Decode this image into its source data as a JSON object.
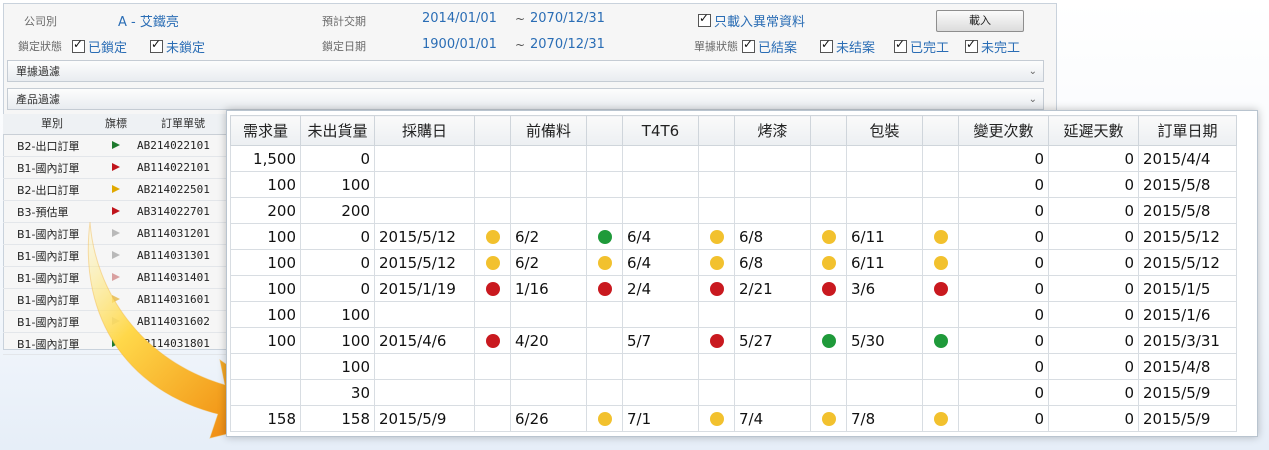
{
  "filters": {
    "company_label": "公司別",
    "company_value": "A - 艾鐵亮",
    "lock_status_label": "鎖定狀態",
    "lock_options": [
      "已鎖定",
      "未鎖定"
    ],
    "expected_label": "預計交期",
    "expected_from": "2014/01/01",
    "expected_to": "2070/12/31",
    "lock_date_label": "鎖定日期",
    "lock_from": "1900/01/01",
    "lock_to": "2070/12/31",
    "range_sep": "~",
    "abnormal_only": "只載入異常資料",
    "doc_status_label": "單據狀態",
    "doc_status_options": [
      "已結案",
      "未结案",
      "已完工",
      "未完工"
    ],
    "import_button": "載入"
  },
  "sections": {
    "doc_filter": "單據過濾",
    "product_filter": "產品過濾"
  },
  "left_table": {
    "headers": [
      "單別",
      "旗標",
      "訂單單號"
    ],
    "rows": [
      {
        "type": "B2-出口訂單",
        "flag_color": "#1e7a2e",
        "no": "AB214022101"
      },
      {
        "type": "B1-國內訂單",
        "flag_color": "#c0141b",
        "no": "AB114022101"
      },
      {
        "type": "B2-出口訂單",
        "flag_color": "#e0a800",
        "no": "AB214022501"
      },
      {
        "type": "B3-預估單",
        "flag_color": "#c0141b",
        "no": "AB314022701"
      },
      {
        "type": "B1-國內訂單",
        "flag_color": "#b9b9b9",
        "no": "AB114031201"
      },
      {
        "type": "B1-國內訂單",
        "flag_color": "#b9b9b9",
        "no": "AB114031301"
      },
      {
        "type": "B1-國內訂單",
        "flag_color": "#d9a0a0",
        "no": "AB114031401"
      },
      {
        "type": "B1-國內訂單",
        "flag_color": "#e8c46a",
        "no": "AB114031601"
      },
      {
        "type": "B1-國內訂單",
        "flag_color": "#b9b9b9",
        "no": "AB114031602"
      },
      {
        "type": "B1-國內訂單",
        "flag_color": "#1e7a2e",
        "no": "AB114031801"
      }
    ]
  },
  "grid": {
    "headers": [
      "需求量",
      "未出貨量",
      "採購日",
      "",
      "前備料",
      "",
      "T4T6",
      "",
      "烤漆",
      "",
      "包裝",
      "",
      "變更次數",
      "延遲天數",
      "訂單日期"
    ],
    "rows": [
      {
        "demand": "1,500",
        "unshipped": "0",
        "purchase": "",
        "purchase_dot": "",
        "prep": "",
        "prep_dot": "",
        "t4t6": "",
        "t4t6_dot": "",
        "paint": "",
        "paint_dot": "",
        "pack": "",
        "pack_dot": "",
        "changes": "0",
        "delay": "0",
        "order_date": "2015/4/4"
      },
      {
        "demand": "100",
        "unshipped": "100",
        "purchase": "",
        "purchase_dot": "",
        "prep": "",
        "prep_dot": "",
        "t4t6": "",
        "t4t6_dot": "",
        "paint": "",
        "paint_dot": "",
        "pack": "",
        "pack_dot": "",
        "changes": "0",
        "delay": "0",
        "order_date": "2015/5/8"
      },
      {
        "demand": "200",
        "unshipped": "200",
        "purchase": "",
        "purchase_dot": "",
        "prep": "",
        "prep_dot": "",
        "t4t6": "",
        "t4t6_dot": "",
        "paint": "",
        "paint_dot": "",
        "pack": "",
        "pack_dot": "",
        "changes": "0",
        "delay": "0",
        "order_date": "2015/5/8"
      },
      {
        "demand": "100",
        "unshipped": "0",
        "purchase": "2015/5/12",
        "purchase_dot": "yellow",
        "prep": "6/2",
        "prep_dot": "green",
        "t4t6": "6/4",
        "t4t6_dot": "yellow",
        "paint": "6/8",
        "paint_dot": "yellow",
        "pack": "6/11",
        "pack_dot": "yellow",
        "changes": "0",
        "delay": "0",
        "order_date": "2015/5/12"
      },
      {
        "demand": "100",
        "unshipped": "0",
        "purchase": "2015/5/12",
        "purchase_dot": "yellow",
        "prep": "6/2",
        "prep_dot": "yellow",
        "t4t6": "6/4",
        "t4t6_dot": "yellow",
        "paint": "6/8",
        "paint_dot": "yellow",
        "pack": "6/11",
        "pack_dot": "yellow",
        "changes": "0",
        "delay": "0",
        "order_date": "2015/5/12"
      },
      {
        "demand": "100",
        "unshipped": "0",
        "purchase": "2015/1/19",
        "purchase_dot": "red",
        "prep": "1/16",
        "prep_dot": "red",
        "t4t6": "2/4",
        "t4t6_dot": "red",
        "paint": "2/21",
        "paint_dot": "red",
        "pack": "3/6",
        "pack_dot": "red",
        "changes": "0",
        "delay": "0",
        "order_date": "2015/1/5"
      },
      {
        "demand": "100",
        "unshipped": "100",
        "purchase": "",
        "purchase_dot": "",
        "prep": "",
        "prep_dot": "",
        "t4t6": "",
        "t4t6_dot": "",
        "paint": "",
        "paint_dot": "",
        "pack": "",
        "pack_dot": "",
        "changes": "0",
        "delay": "0",
        "order_date": "2015/1/6"
      },
      {
        "demand": "100",
        "unshipped": "100",
        "purchase": "2015/4/6",
        "purchase_dot": "red",
        "prep": "4/20",
        "prep_dot": "",
        "t4t6": "5/7",
        "t4t6_dot": "red",
        "paint": "5/27",
        "paint_dot": "green",
        "pack": "5/30",
        "pack_dot": "green",
        "changes": "0",
        "delay": "0",
        "order_date": "2015/3/31"
      },
      {
        "demand": "",
        "unshipped": "100",
        "purchase": "",
        "purchase_dot": "",
        "prep": "",
        "prep_dot": "",
        "t4t6": "",
        "t4t6_dot": "",
        "paint": "",
        "paint_dot": "",
        "pack": "",
        "pack_dot": "",
        "changes": "0",
        "delay": "0",
        "order_date": "2015/4/8"
      },
      {
        "demand": "",
        "unshipped": "30",
        "purchase": "",
        "purchase_dot": "",
        "prep": "",
        "prep_dot": "",
        "t4t6": "",
        "t4t6_dot": "",
        "paint": "",
        "paint_dot": "",
        "pack": "",
        "pack_dot": "",
        "changes": "0",
        "delay": "0",
        "order_date": "2015/5/9"
      },
      {
        "demand": "158",
        "unshipped": "158",
        "purchase": "2015/5/9",
        "purchase_dot": "",
        "prep": "6/26",
        "prep_dot": "yellow",
        "t4t6": "7/1",
        "t4t6_dot": "yellow",
        "paint": "7/4",
        "paint_dot": "yellow",
        "pack": "7/8",
        "pack_dot": "yellow",
        "changes": "0",
        "delay": "0",
        "order_date": "2015/5/9"
      }
    ]
  }
}
